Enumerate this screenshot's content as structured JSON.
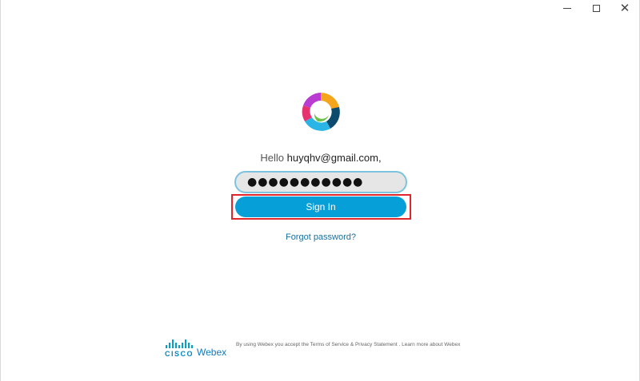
{
  "window": {
    "controls": {
      "minimize": "minimize",
      "maximize": "maximize",
      "close": "✕"
    }
  },
  "greeting": {
    "prefix": "Hello",
    "email": "huyqhv@gmail.com,"
  },
  "password_field": {
    "value": "●●●●●●●●●●●"
  },
  "signin_button": {
    "label": "Sign In",
    "color": "#079fd8"
  },
  "highlight": {
    "color": "#e0262b"
  },
  "forgot_link": {
    "label": "Forgot password?"
  },
  "footer": {
    "brand_cisco": "CISCO",
    "brand_webex": "Webex",
    "legal": "By using Webex you accept the Terms of Service & Privacy Statement . Learn more about Webex"
  },
  "logo": {
    "name": "webex-logo-icon"
  }
}
